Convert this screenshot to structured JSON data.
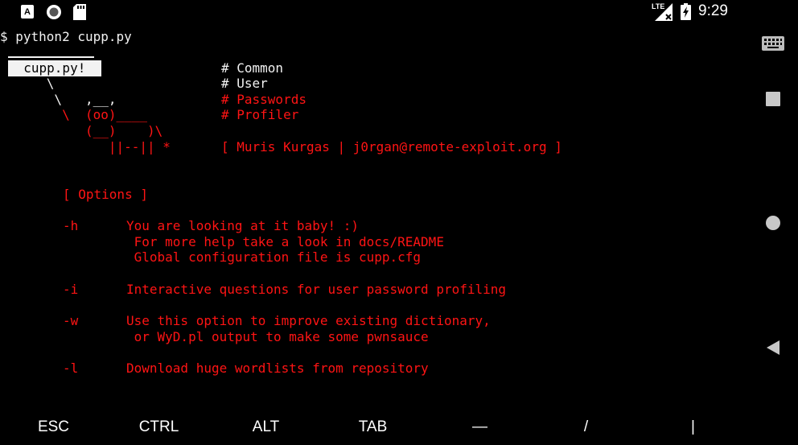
{
  "status_bar": {
    "left_icons": [
      "app-a-icon",
      "record-icon",
      "sd-card-icon"
    ],
    "network_label": "LTE",
    "time": "9:29",
    "colors": {
      "icon": "#ffffff",
      "background": "#000000"
    }
  },
  "terminal": {
    "colors": {
      "foreground": "#f2f2f2",
      "accent": "#ff1414",
      "background": "#000000"
    },
    "prompt_line": "$ python2 cupp.py",
    "banner": {
      "logo_label": "  cupp.py!  ",
      "art": [
        "      \\",
        "       \\   ,__,",
        "        \\  (oo)____",
        "           (__)    )\\",
        "              ||--|| *"
      ],
      "menu": [
        "# Common",
        "# User",
        "# Passwords",
        "# Profiler"
      ],
      "author": "[ Muris Kurgas | j0rgan@remote-exploit.org ]"
    },
    "options_title": "[ Options ]",
    "options": [
      {
        "flag": "-h",
        "lines": [
          "You are looking at it baby! :)",
          " For more help take a look in docs/README",
          " Global configuration file is cupp.cfg"
        ]
      },
      {
        "flag": "-i",
        "lines": [
          "Interactive questions for user password profiling"
        ]
      },
      {
        "flag": "-w",
        "lines": [
          "Use this option to improve existing dictionary,",
          " or WyD.pl output to make some pwnsauce"
        ]
      },
      {
        "flag": "-l",
        "lines": [
          "Download huge wordlists from repository"
        ]
      }
    ]
  },
  "extra_keys": [
    "ESC",
    "CTRL",
    "ALT",
    "TAB",
    "—",
    "/",
    "|"
  ],
  "nav_bar": {
    "buttons": [
      "keyboard-icon",
      "recents-icon",
      "home-icon",
      "back-icon"
    ]
  }
}
